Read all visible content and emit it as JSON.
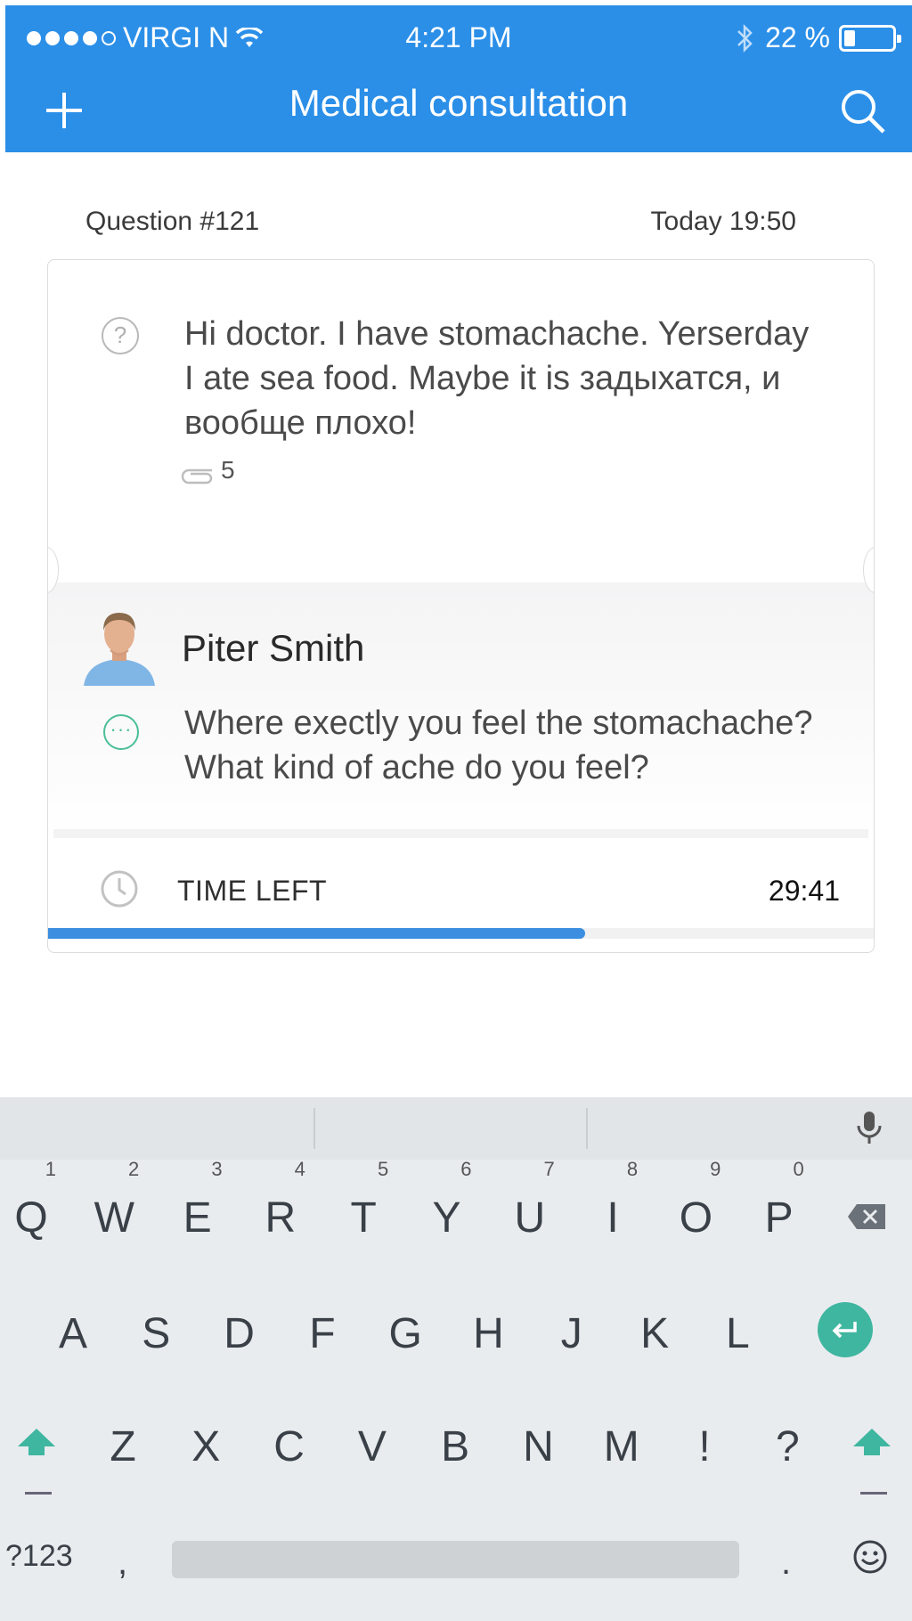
{
  "status_bar": {
    "carrier": "VIRGI N",
    "time": "4:21 PM",
    "battery": "22 %"
  },
  "nav": {
    "title": "Medical consultation",
    "add_icon": "plus-icon",
    "search_icon": "search-icon"
  },
  "question": {
    "number": "Question #121",
    "time": "Today 19:50",
    "text": "Hi doctor. I have stomachache. Yerserday I ate sea food. Maybe it is задыхатся, и вообще плохо!",
    "attachments": "5"
  },
  "answer": {
    "doctor_name": "Piter Smith",
    "text": "Where exectly you feel the stomachache? What kind of ache do you feel?"
  },
  "timer": {
    "label": "TIME LEFT",
    "value": "29:41",
    "progress_fraction": 0.65
  },
  "keyboard": {
    "row1": [
      {
        "k": "Q",
        "n": "1"
      },
      {
        "k": "W",
        "n": "2"
      },
      {
        "k": "E",
        "n": "3"
      },
      {
        "k": "R",
        "n": "4"
      },
      {
        "k": "T",
        "n": "5"
      },
      {
        "k": "Y",
        "n": "6"
      },
      {
        "k": "U",
        "n": "7"
      },
      {
        "k": "I",
        "n": "8"
      },
      {
        "k": "O",
        "n": "9"
      },
      {
        "k": "P",
        "n": "0"
      }
    ],
    "row2": [
      "A",
      "S",
      "D",
      "F",
      "G",
      "H",
      "J",
      "K",
      "L"
    ],
    "row3": [
      "Z",
      "X",
      "C",
      "V",
      "B",
      "N",
      "M",
      "!",
      "?"
    ],
    "symbols_key": "?123",
    "comma_key": ",",
    "period_key": "."
  },
  "colors": {
    "header": "#2b8fe8",
    "accent_green": "#3fb6a0",
    "progress": "#3b8ee0"
  }
}
